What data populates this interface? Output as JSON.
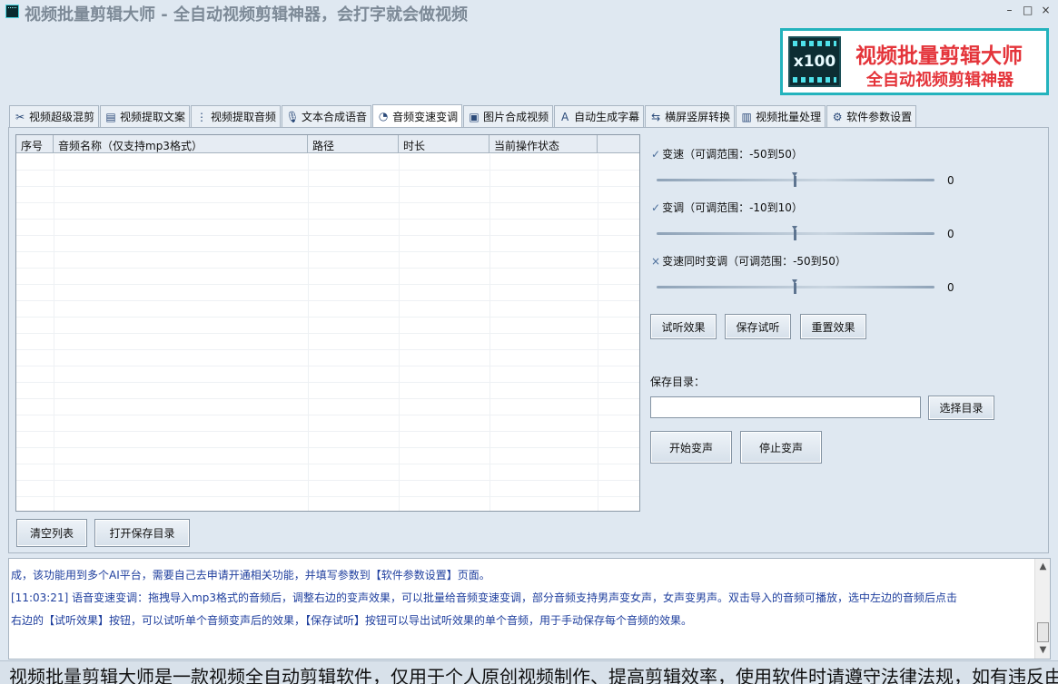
{
  "window": {
    "title": "视频批量剪辑大师 - 全自动视频剪辑神器，会打字就会做视频",
    "controls": [
      "–",
      "□",
      "×"
    ]
  },
  "banner": {
    "logo_text": "x100",
    "line1": "视频批量剪辑大师",
    "line2": "全自动视频剪辑神器"
  },
  "tabs": [
    {
      "label": "视频超级混剪",
      "icon": "scissors-icon",
      "glyph": "✂"
    },
    {
      "label": "视频提取文案",
      "icon": "document-icon",
      "glyph": "▤"
    },
    {
      "label": "视频提取音频",
      "icon": "audio-wave-icon",
      "glyph": "⋮"
    },
    {
      "label": "文本合成语音",
      "icon": "microphone-icon",
      "glyph": "🎙"
    },
    {
      "label": "音频变速变调",
      "icon": "gauge-icon",
      "glyph": "◔",
      "active": true
    },
    {
      "label": "图片合成视频",
      "icon": "image-icon",
      "glyph": "▣"
    },
    {
      "label": "自动生成字幕",
      "icon": "subtitle-icon",
      "glyph": "A"
    },
    {
      "label": "横屏竖屏转换",
      "icon": "rotate-screen-icon",
      "glyph": "⇆"
    },
    {
      "label": "视频批量处理",
      "icon": "film-icon",
      "glyph": "▥"
    },
    {
      "label": "软件参数设置",
      "icon": "gear-icon",
      "glyph": "⚙"
    }
  ],
  "list": {
    "columns": [
      "序号",
      "音频名称（仅支持mp3格式）",
      "路径",
      "时长",
      "当前操作状态"
    ],
    "rows": []
  },
  "buttons": {
    "clear_list": "清空列表",
    "open_save_dir": "打开保存目录",
    "preview": "试听效果",
    "save_preview": "保存试听",
    "reset": "重置效果",
    "choose_dir": "选择目录",
    "start": "开始变声",
    "stop": "停止变声"
  },
  "controls": {
    "speed": {
      "label": "变速（可调范围：-50到50）",
      "mark": "✓",
      "checked": true,
      "value": "0"
    },
    "pitch": {
      "label": "变调（可调范围：-10到10）",
      "mark": "✓",
      "checked": true,
      "value": "0"
    },
    "both": {
      "label": "变速同时变调（可调范围：-50到50）",
      "mark": "×",
      "checked": false,
      "value": "0"
    },
    "save_dir_label": "保存目录：",
    "save_dir_value": ""
  },
  "log": [
    "成，该功能用到多个AI平台，需要自己去申请开通相关功能，并填写参数到【软件参数设置】页面。",
    "[11:03:21] 语音变速变调：拖拽导入mp3格式的音频后，调整右边的变声效果，可以批量给音频变速变调，部分音频支持男声变女声，女声变男声。双击导入的音频可播放，选中左边的音频后点击",
    "右边的【试听效果】按钮，可以试听单个音频变声后的效果，【保存试听】按钮可以导出试听效果的单个音频，用于手动保存每个音频的效果。"
  ],
  "ticker": "视频批量剪辑大师是一款视频全自动剪辑软件，仅用于个人原创视频制作、提高剪辑效率，使用软件时请遵守法律法规，如有违反由"
}
